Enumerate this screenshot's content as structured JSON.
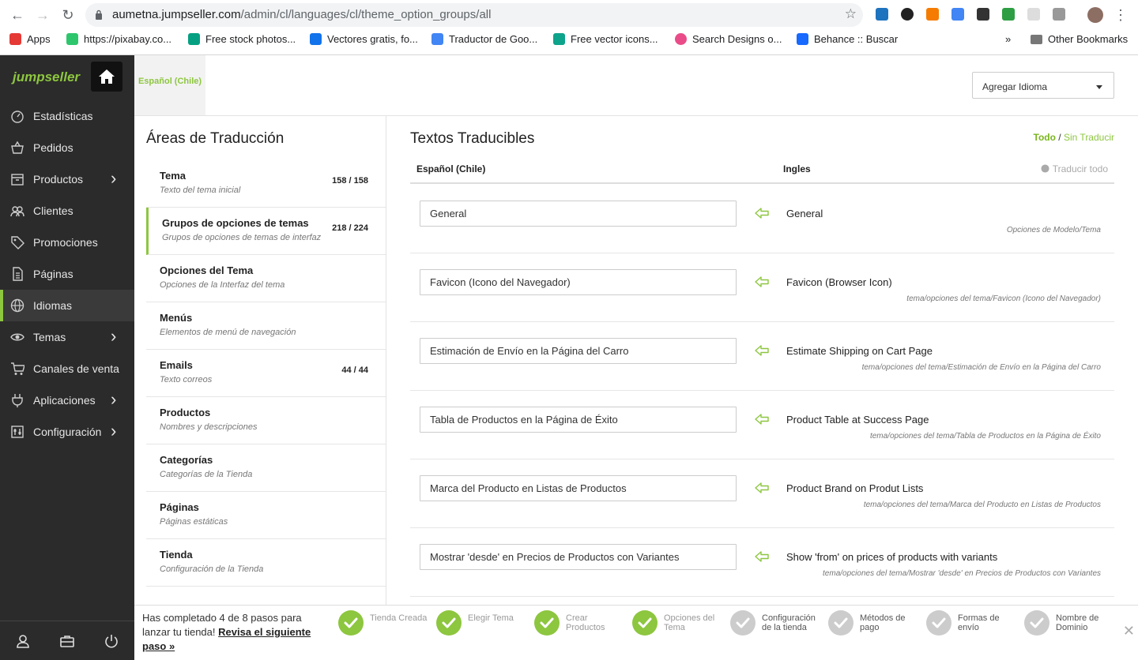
{
  "browser": {
    "url_host": "aumetna.jumpseller.com",
    "url_path": "/admin/cl/languages/cl/theme_option_groups/all",
    "bookmarks": [
      {
        "label": "Apps",
        "icon": "apps-grid-icon",
        "color": "#e53935"
      },
      {
        "label": "https://pixabay.co...",
        "icon": "pixabay-icon",
        "color": "#2ec66d"
      },
      {
        "label": "Free stock photos...",
        "icon": "pexels-icon",
        "color": "#05a081"
      },
      {
        "label": "Vectores gratis, fo...",
        "icon": "freepik-icon",
        "color": "#1273eb"
      },
      {
        "label": "Traductor de Goo...",
        "icon": "google-translate-icon",
        "color": "#4285f4"
      },
      {
        "label": "Free vector icons...",
        "icon": "flaticon-icon",
        "color": "#0ea38b"
      },
      {
        "label": "Search Designs o...",
        "icon": "dribbble-icon",
        "color": "#ea4c89"
      },
      {
        "label": "Behance :: Buscar",
        "icon": "behance-icon",
        "color": "#1769ff"
      }
    ],
    "more": "»",
    "other_bookmarks": "Other Bookmarks"
  },
  "sidebar": {
    "brand": "jumpseller",
    "items": [
      {
        "label": "Estadísticas",
        "icon": "gauge-icon",
        "chevron": false,
        "active": false
      },
      {
        "label": "Pedidos",
        "icon": "basket-icon",
        "chevron": false,
        "active": false
      },
      {
        "label": "Productos",
        "icon": "box-icon",
        "chevron": true,
        "active": false
      },
      {
        "label": "Clientes",
        "icon": "users-icon",
        "chevron": false,
        "active": false
      },
      {
        "label": "Promociones",
        "icon": "tag-icon",
        "chevron": false,
        "active": false
      },
      {
        "label": "Páginas",
        "icon": "page-icon",
        "chevron": false,
        "active": false
      },
      {
        "label": "Idiomas",
        "icon": "globe-icon",
        "chevron": false,
        "active": true
      },
      {
        "label": "Temas",
        "icon": "eye-icon",
        "chevron": true,
        "active": false
      },
      {
        "label": "Canales de venta",
        "icon": "cart-icon",
        "chevron": false,
        "active": false
      },
      {
        "label": "Aplicaciones",
        "icon": "plug-icon",
        "chevron": true,
        "active": false
      },
      {
        "label": "Configuración",
        "icon": "settings-icon",
        "chevron": true,
        "active": false
      }
    ]
  },
  "header": {
    "language_tab": "Español (Chile)",
    "add_language": "Agregar Idioma"
  },
  "areas": {
    "title": "Áreas de Traducción",
    "items": [
      {
        "title": "Tema",
        "subtitle": "Texto del tema inicial",
        "count": "158 / 158"
      },
      {
        "title": "Grupos de opciones de temas",
        "subtitle": "Grupos de opciones de temas de interfaz",
        "count": "218 / 224"
      },
      {
        "title": "Opciones del Tema",
        "subtitle": "Opciones de la Interfaz del tema",
        "count": ""
      },
      {
        "title": "Menús",
        "subtitle": "Elementos de menú de navegación",
        "count": ""
      },
      {
        "title": "Emails",
        "subtitle": "Texto correos",
        "count": "44 / 44"
      },
      {
        "title": "Productos",
        "subtitle": "Nombres y descripciones",
        "count": ""
      },
      {
        "title": "Categorías",
        "subtitle": "Categorías de la Tienda",
        "count": ""
      },
      {
        "title": "Páginas",
        "subtitle": "Páginas estáticas",
        "count": ""
      },
      {
        "title": "Tienda",
        "subtitle": "Configuración de la Tienda",
        "count": ""
      }
    ]
  },
  "texts": {
    "title": "Textos Traducibles",
    "filter_all": "Todo",
    "filter_sep": "/",
    "filter_untranslated": "Sin Traducir",
    "col_source": "Español (Chile)",
    "col_target": "Ingles",
    "translate_all": "Traducir todo",
    "rows": [
      {
        "value": "General",
        "original": "General",
        "path": "Opciones de Modelo/Tema"
      },
      {
        "value": "Favicon (Icono del Navegador)",
        "original": "Favicon (Browser Icon)",
        "path": "tema/opciones del tema/Favicon (Icono del Navegador)"
      },
      {
        "value": "Estimación de Envío en la Página del Carro",
        "original": "Estimate Shipping on Cart Page",
        "path": "tema/opciones del tema/Estimación de Envío en la Página del Carro"
      },
      {
        "value": "Tabla de Productos en la Página de Éxito",
        "original": "Product Table at Success Page",
        "path": "tema/opciones del tema/Tabla de Productos en la Página de Éxito"
      },
      {
        "value": "Marca del Producto en Listas de Productos",
        "original": "Product Brand on Produt Lists",
        "path": "tema/opciones del tema/Marca del Producto en Listas de Productos"
      },
      {
        "value": "Mostrar 'desde' en Precios de Productos con Variantes",
        "original": "Show 'from' on prices of products with variants",
        "path": "tema/opciones del tema/Mostrar 'desde' en Precios de Productos con Variantes"
      }
    ]
  },
  "onboarding": {
    "text": "Has completado 4 de 8 pasos para lanzar tu tienda!",
    "link": "Revisa el siguiente paso »",
    "steps": [
      {
        "label": "Tienda Creada",
        "done": true
      },
      {
        "label": "Elegir Tema",
        "done": true
      },
      {
        "label": "Crear Productos",
        "done": true
      },
      {
        "label": "Opciones del Tema",
        "done": true
      },
      {
        "label": "Configuración de la tienda",
        "done": false
      },
      {
        "label": "Métodos de pago",
        "done": false
      },
      {
        "label": "Formas de envío",
        "done": false
      },
      {
        "label": "Nombre de Dominio",
        "done": false
      }
    ],
    "close": "✕"
  },
  "colors": {
    "accent": "#8dc63f",
    "sidebar_bg": "#2b2b2b",
    "step_done": "#8dc63f",
    "step_pending": "#cccccc"
  }
}
